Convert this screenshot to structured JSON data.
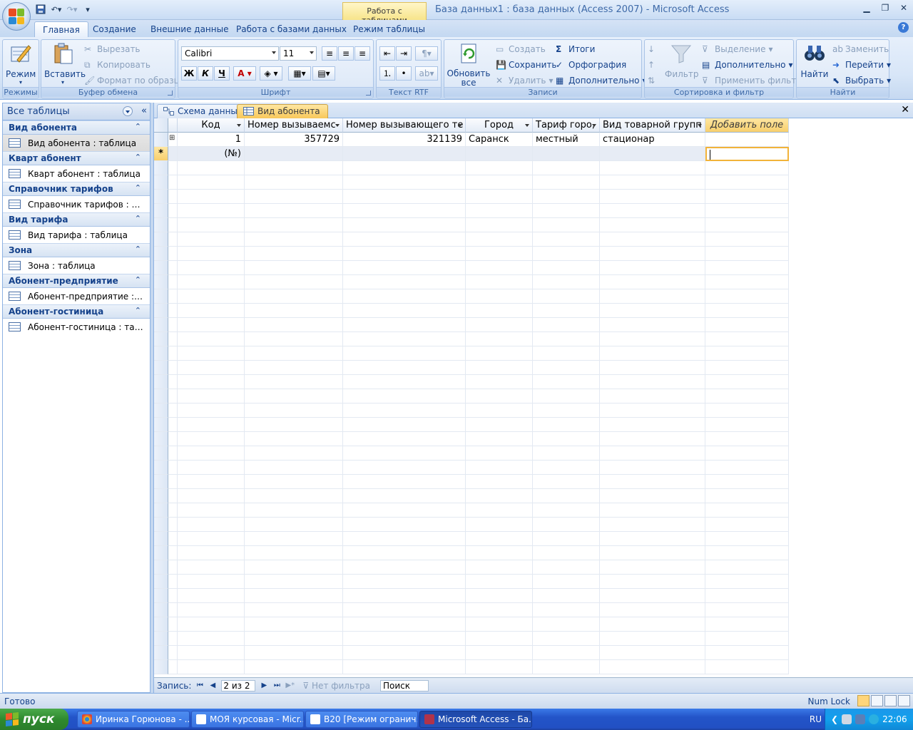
{
  "window": {
    "title": "База данных1 : база данных (Access 2007) - Microsoft Access",
    "contextual_tab_group": "Работа с таблицами"
  },
  "ribbon_tabs": [
    {
      "label": "Главная",
      "active": true
    },
    {
      "label": "Создание"
    },
    {
      "label": "Внешние данные"
    },
    {
      "label": "Работа с базами данных"
    },
    {
      "label": "Режим таблицы"
    }
  ],
  "ribbon": {
    "views": {
      "label": "Режимы",
      "view_button": "Режим"
    },
    "clipboard": {
      "label": "Буфер обмена",
      "paste": "Вставить",
      "cut": "Вырезать",
      "copy": "Копировать",
      "format_painter": "Формат по образцу"
    },
    "font": {
      "label": "Шрифт",
      "font_name": "Calibri",
      "font_size": "11",
      "bold": "Ж",
      "italic": "К",
      "underline": "Ч",
      "font_color": "A"
    },
    "rich_text": {
      "label": "Текст RTF"
    },
    "records": {
      "label": "Записи",
      "refresh": "Обновить все",
      "new": "Создать",
      "save": "Сохранить",
      "delete": "Удалить",
      "totals": "Итоги",
      "spelling": "Орфография",
      "more": "Дополнительно"
    },
    "sort_filter": {
      "label": "Сортировка и фильтр",
      "filter": "Фильтр",
      "selection": "Выделение",
      "advanced": "Дополнительно",
      "toggle_filter": "Применить фильтр"
    },
    "find": {
      "label": "Найти",
      "find": "Найти",
      "replace": "Заменить",
      "goto": "Перейти",
      "select": "Выбрать"
    }
  },
  "nav_pane": {
    "title": "Все таблицы",
    "groups": [
      {
        "header": "Вид абонента",
        "item": "Вид абонента : таблица",
        "selected": true
      },
      {
        "header": "Кварт абонент",
        "item": "Кварт абонент : таблица"
      },
      {
        "header": "Справочник тарифов",
        "item": "Справочник тарифов : табл..."
      },
      {
        "header": "Вид тарифа",
        "item": "Вид тарифа : таблица"
      },
      {
        "header": "Зона",
        "item": "Зона : таблица"
      },
      {
        "header": "Абонент-предприятие",
        "item": "Абонент-предприятие : таб..."
      },
      {
        "header": "Абонент-гостиница",
        "item": "Абонент-гостиница : таблица"
      }
    ]
  },
  "doc_tabs": [
    {
      "label": "Схема данных"
    },
    {
      "label": "Вид абонента",
      "active": true
    }
  ],
  "datasheet": {
    "columns": [
      "Код",
      "Номер вызываемс",
      "Номер вызывающего те",
      "Город",
      "Тариф горо,",
      "Вид товарной групп",
      "Добавить поле"
    ],
    "rows": [
      [
        "1",
        "357729",
        "321139",
        "Саранск",
        "местный",
        "стационар",
        ""
      ]
    ],
    "new_row_marker": "*",
    "new_row_key": "(№)"
  },
  "record_nav": {
    "label": "Запись:",
    "position": "2 из 2",
    "filter_status": "Нет фильтра",
    "search": "Поиск"
  },
  "status_bar": {
    "ready": "Готово",
    "num_lock": "Num Lock"
  },
  "taskbar": {
    "start": "пуск",
    "tasks": [
      {
        "label": "Иринка Горюнова - ..."
      },
      {
        "label": "МОЯ курсовая - Micr..."
      },
      {
        "label": "В20 [Режим огранич..."
      },
      {
        "label": "Microsoft Access - Ба...",
        "active": true
      }
    ],
    "language": "RU",
    "time": "22:06"
  },
  "colors": {
    "accent": "#15428b",
    "active_tab": "#f8c85a",
    "taskbar": "#2354c8",
    "start": "#2f8a2f"
  }
}
